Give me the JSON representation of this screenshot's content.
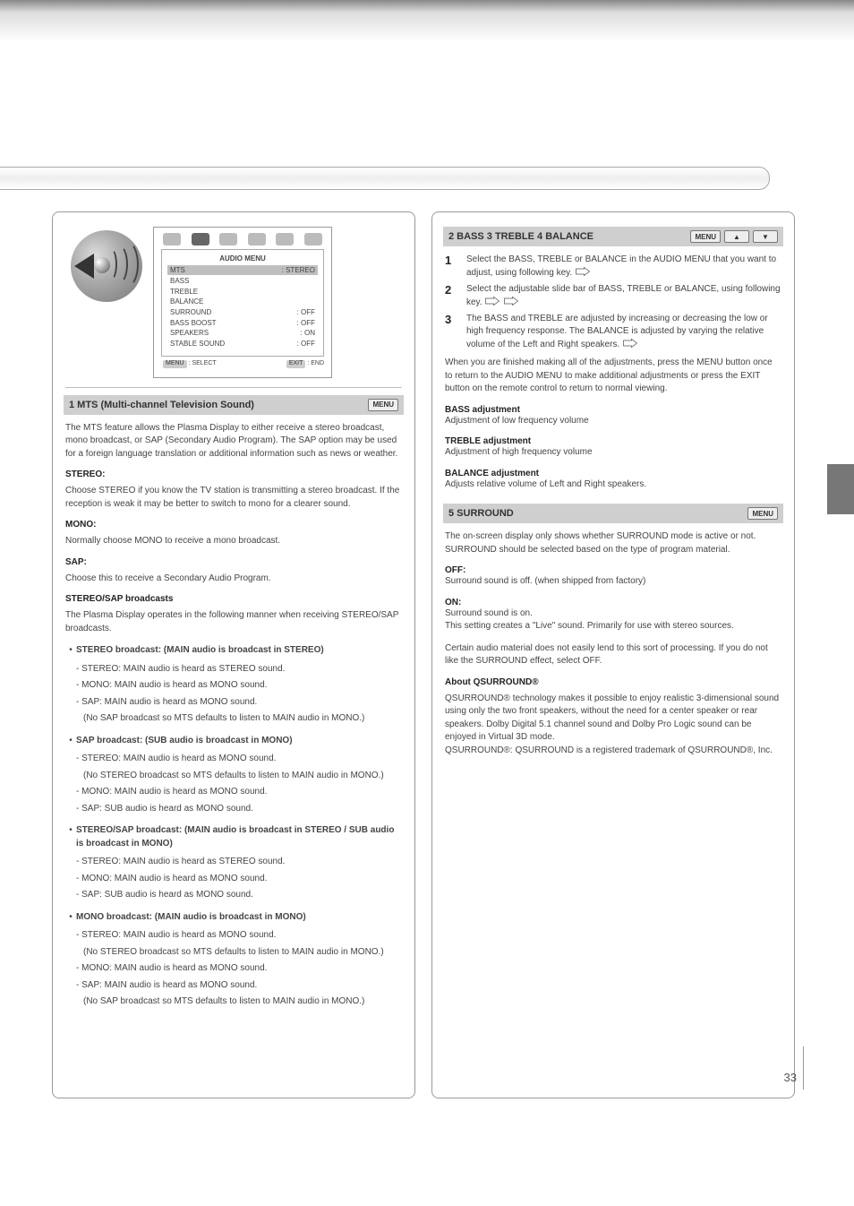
{
  "page_number": "33",
  "osd": {
    "menu_title": "AUDIO MENU",
    "items": [
      {
        "label": "MTS",
        "value": "STEREO"
      },
      {
        "label": "BASS",
        "slider": true
      },
      {
        "label": "TREBLE",
        "slider": true
      },
      {
        "label": "BALANCE",
        "slider": true
      },
      {
        "label": "SURROUND",
        "value": "OFF"
      },
      {
        "label": "BASS BOOST",
        "value": "OFF"
      },
      {
        "label": "SPEAKERS",
        "value": "ON"
      },
      {
        "label": "STABLE SOUND",
        "value": "OFF"
      }
    ],
    "hint_select": "SELECT",
    "hint_select_key": "MENU",
    "hint_end": "END",
    "hint_end_key": "EXIT"
  },
  "left": {
    "h1_main": "1 MTS (Multi-channel Television Sound)",
    "h1_keys": "MENU",
    "mts_intro": "The MTS feature allows the Plasma Display to either receive a stereo broadcast, mono broadcast, or SAP (Secondary Audio Program). The SAP option may be used for a foreign language translation or additional information such as news or weather.",
    "mts_stereo_label": "STEREO:",
    "mts_stereo": "Choose STEREO if you know the TV station is transmitting a stereo broadcast. If the reception is weak it may be better to switch to mono for a clearer sound.",
    "mts_mono_label": "MONO:",
    "mts_mono": "Normally choose MONO to receive a mono broadcast.",
    "mts_sap_label": "SAP:",
    "mts_sap": "Choose this to receive a Secondary Audio Program.",
    "mts_modes_head": "STEREO/SAP broadcasts",
    "mts_modes_intro": "The Plasma Display operates in the following manner when receiving STEREO/SAP broadcasts.",
    "modes": [
      {
        "title": "STEREO broadcast: (MAIN audio is broadcast in STEREO)",
        "stereo": "- STEREO: MAIN audio is heard as STEREO sound.",
        "mono": "- MONO: MAIN audio is heard as MONO sound.",
        "sap": "- SAP: MAIN audio is heard as MONO sound.",
        "note": "(No SAP broadcast so MTS defaults to listen to MAIN audio in MONO.)"
      },
      {
        "title": "SAP broadcast: (SUB audio is broadcast in MONO)",
        "stereo": "- STEREO: MAIN audio is heard as MONO sound.",
        "note1": "(No STEREO broadcast so MTS defaults to listen to MAIN audio in MONO.)",
        "mono": "- MONO: MAIN audio is heard as MONO sound.",
        "sap": "- SAP: SUB audio is heard as MONO sound."
      },
      {
        "title": "STEREO/SAP broadcast: (MAIN audio is broadcast in STEREO / SUB audio is broadcast in MONO)",
        "stereo": "- STEREO: MAIN audio is heard as STEREO sound.",
        "mono": "- MONO: MAIN audio is heard as MONO sound.",
        "sap": "- SAP: SUB audio is heard as MONO sound."
      },
      {
        "title": "MONO broadcast: (MAIN audio is broadcast in MONO)",
        "stereo": "- STEREO: MAIN audio is heard as MONO sound.",
        "note1": "(No STEREO broadcast so MTS defaults to listen to MAIN audio in MONO.)",
        "mono": "- MONO: MAIN audio is heard as MONO sound.",
        "sap": "- SAP: MAIN audio is heard as MONO sound.",
        "note2": "(No SAP broadcast so MTS defaults to listen to MAIN audio in MONO.)"
      }
    ]
  },
  "right": {
    "h2_pre": "2 BASS  3 TREBLE  4 BALANCE",
    "h2_keys": [
      "MENU",
      "▲",
      "▼"
    ],
    "steps234": [
      {
        "n": "1",
        "t": "Select the BASS, TREBLE or BALANCE in the AUDIO MENU that you want to adjust, using following key."
      },
      {
        "n": "2",
        "t": "Select the adjustable slide bar of BASS, TREBLE or BALANCE, using following key."
      },
      {
        "n": "3",
        "t": "The BASS and TREBLE are adjusted by increasing or decreasing the low or high frequency response. The BALANCE is adjusted by varying the relative volume of the Left and Right speakers."
      }
    ],
    "note234": "When you are finished making all of the adjustments, press the MENU button once to return to the AUDIO MENU to make additional adjustments or press the EXIT button on the remote control to return to normal viewing.",
    "bass_label": "BASS adjustment",
    "bass_text": "Adjustment of low frequency volume",
    "treble_label": "TREBLE adjustment",
    "treble_text": "Adjustment of high frequency volume",
    "balance_label": "BALANCE adjustment",
    "balance_text": "Adjusts relative volume of Left and Right speakers.",
    "h5_main": "5 SURROUND",
    "h5_keys": "MENU",
    "surround_intro": "The on-screen display only shows whether SURROUND mode is active or not. SURROUND should be selected based on the type of program material.",
    "surround_off_label": "OFF:",
    "surround_off": "Surround sound is off. (when shipped from factory)",
    "surround_on_label": "ON:",
    "surround_on": "Surround sound is on.\nThis setting creates a \"Live\" sound. Primarily for use with stereo sources.",
    "surround_note": "Certain audio material does not easily lend to this sort of processing. If you do not like the SURROUND effect, select OFF.",
    "qsurround_head": "About QSURROUND®",
    "qsurround_text": "QSURROUND® technology makes it possible to enjoy realistic 3-dimensional sound using only the two front speakers, without the need for a center speaker or rear speakers. Dolby Digital 5.1 channel sound and Dolby Pro Logic sound can be enjoyed in Virtual 3D mode.\nQSURROUND®: QSURROUND is a registered trademark of QSURROUND®, Inc."
  }
}
